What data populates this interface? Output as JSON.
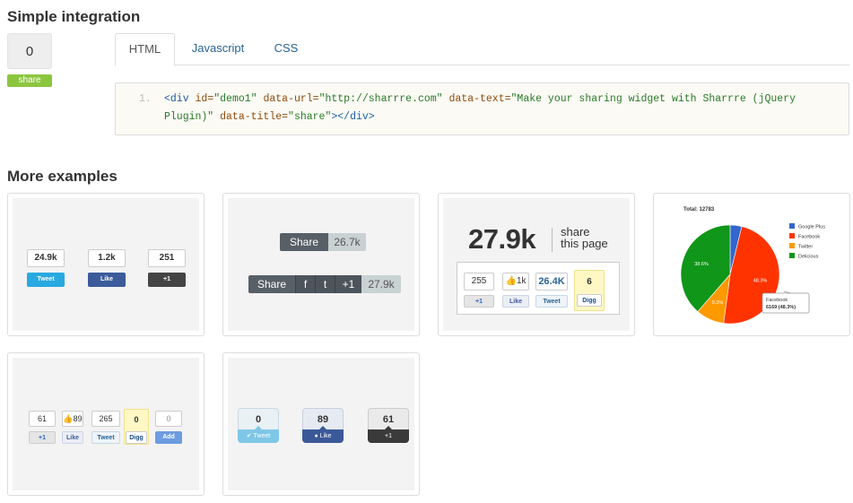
{
  "simple": {
    "title": "Simple integration",
    "count": "0",
    "badge": "share",
    "tabs": [
      "HTML",
      "Javascript",
      "CSS"
    ],
    "code": {
      "line_number": "1.",
      "line1_tag_open": "<div ",
      "attr_id": "id=",
      "val_id": "\"demo1\"",
      "attr_url": " data-url=",
      "val_url": "\"http://sharrre.com\"",
      "attr_text": " data-text=",
      "val_text": "\"Make your sharing widget with Sharrre (jQuery",
      "val_text2": "Plugin)\"",
      "attr_title": " data-title=",
      "val_title": "\"share\"",
      "tag_close": "></div>"
    }
  },
  "more": {
    "title": "More examples",
    "ex1": {
      "counts": [
        "24.9k",
        "1.2k",
        "251"
      ],
      "buttons": [
        "Tweet",
        "Like",
        "+1"
      ]
    },
    "ex2": {
      "row1": {
        "label": "Share",
        "count": "26.7k"
      },
      "row2": {
        "label": "Share",
        "services": [
          "f",
          "t",
          "+1"
        ],
        "count": "27.9k"
      }
    },
    "ex3": {
      "total": "27.9k",
      "share_line1": "share",
      "share_line2": "this page",
      "counts": [
        "255",
        "1k",
        "26.4K",
        "6"
      ],
      "buttons": [
        "+1",
        "Like",
        "Tweet",
        "Digg"
      ]
    },
    "ex4": {
      "total_label": "Total: 12783",
      "legend": [
        "Google Plus",
        "Facebook",
        "Twitter",
        "Delicious"
      ],
      "slice_labels": [
        "48.3%",
        "9.3%",
        "38.6%"
      ],
      "tooltip_title": "Facebook",
      "tooltip_value": "6169 (48.3%)"
    },
    "ex5": {
      "counts": [
        "61",
        "89",
        "265",
        "0",
        "0"
      ],
      "buttons": [
        "+1",
        "Like",
        "Tweet",
        "Digg",
        "Add"
      ]
    },
    "ex6": {
      "counts": [
        "0",
        "89",
        "61"
      ],
      "buttons": [
        "Tweet",
        "Like",
        "+1"
      ]
    }
  },
  "colors": {
    "google_plus": "#3366cc",
    "facebook": "#ff3300",
    "twitter": "#ff9900",
    "delicious": "#109618",
    "share_badge": "#8cc63f",
    "link": "#2a6496"
  },
  "chart_data": {
    "type": "pie",
    "title": "Total: 12783",
    "categories": [
      "Google Plus",
      "Facebook",
      "Twitter",
      "Delicious"
    ],
    "values": [
      3.8,
      48.3,
      9.3,
      38.6
    ],
    "slice_labels": [
      "",
      "48.3%",
      "9.3%",
      "38.6%"
    ],
    "legend_position": "top-right",
    "tooltip": {
      "category": "Facebook",
      "value": "6169 (48.3%)"
    }
  }
}
